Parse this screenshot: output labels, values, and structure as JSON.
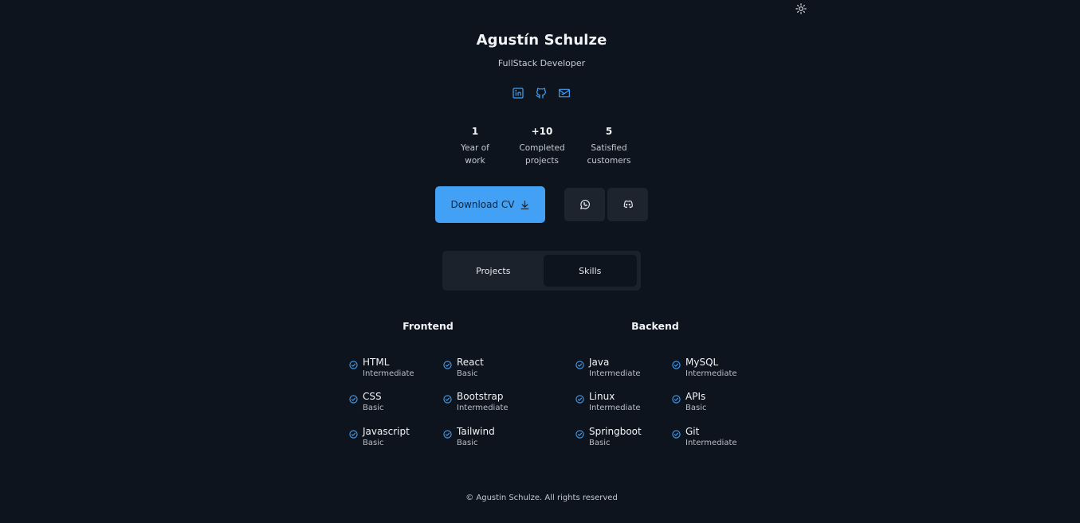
{
  "colors": {
    "background": "#0e141d",
    "accent": "#42a0f5",
    "surface": "#1d242e"
  },
  "header": {
    "name": "Agustín Schulze",
    "role": "FullStack Developer"
  },
  "socials": [
    {
      "icon": "linkedin-icon"
    },
    {
      "icon": "github-icon"
    },
    {
      "icon": "mail-icon"
    }
  ],
  "stats": [
    {
      "value": "1",
      "label_line1": "Year of",
      "label_line2": "work"
    },
    {
      "value": "+10",
      "label_line1": "Completed",
      "label_line2": "projects"
    },
    {
      "value": "5",
      "label_line1": "Satisfied",
      "label_line2": "customers"
    }
  ],
  "actions": {
    "download_label": "Download CV",
    "whatsapp_icon": "whatsapp-icon",
    "discord_icon": "discord-icon"
  },
  "tabs": [
    {
      "label": "Projects",
      "active": false
    },
    {
      "label": "Skills",
      "active": true
    }
  ],
  "frontend": {
    "title": "Frontend",
    "skills": [
      {
        "name": "HTML",
        "level": "Intermediate"
      },
      {
        "name": "React",
        "level": "Basic"
      },
      {
        "name": "CSS",
        "level": "Basic"
      },
      {
        "name": "Bootstrap",
        "level": "Intermediate"
      },
      {
        "name": "Javascript",
        "level": "Basic"
      },
      {
        "name": "Tailwind",
        "level": "Basic"
      }
    ]
  },
  "backend": {
    "title": "Backend",
    "skills": [
      {
        "name": "Java",
        "level": "Intermediate"
      },
      {
        "name": "MySQL",
        "level": "Intermediate"
      },
      {
        "name": "Linux",
        "level": "Intermediate"
      },
      {
        "name": "APIs",
        "level": "Basic"
      },
      {
        "name": "Springboot",
        "level": "Basic"
      },
      {
        "name": "Git",
        "level": "Intermediate"
      }
    ]
  },
  "footer": {
    "text": "© Agustin Schulze. All rights reserved"
  }
}
